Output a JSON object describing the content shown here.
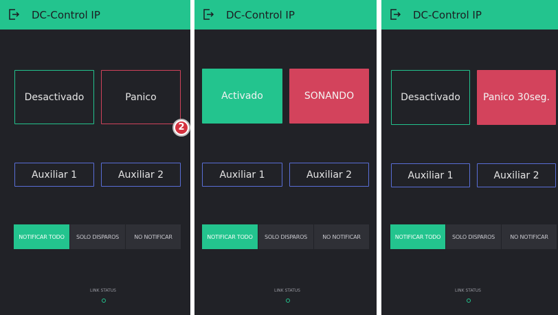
{
  "screens": [
    {
      "title": "DC-Control IP",
      "alarm_button": {
        "label": "Desactivado",
        "style": "outline",
        "color": "#23c48e"
      },
      "panic_button": {
        "label": "Panico",
        "style": "outline",
        "color": "#d3435c"
      },
      "aux1_label": "Auxiliar 1",
      "aux2_label": "Auxiliar 2",
      "segments": [
        "NOTIFICAR TODO",
        "SOLO DISPAROS",
        "NO NOTIFICAR"
      ],
      "active_segment": 0,
      "link_status_label": "LINK STATUS"
    },
    {
      "title": "DC-Control IP",
      "alarm_button": {
        "label": "Activado",
        "style": "filled",
        "color": "#23c48e"
      },
      "panic_button": {
        "label": "SONANDO",
        "style": "filled",
        "color": "#d3435c"
      },
      "aux1_label": "Auxiliar 1",
      "aux2_label": "Auxiliar 2",
      "segments": [
        "NOTIFICAR TODO",
        "SOLO DISPAROS",
        "NO NOTIFICAR"
      ],
      "active_segment": 0,
      "link_status_label": "LINK STATUS"
    },
    {
      "title": "DC-Control IP",
      "alarm_button": {
        "label": "Desactivado",
        "style": "outline",
        "color": "#23c48e"
      },
      "panic_button": {
        "label": "Panico 30seg.",
        "style": "filled",
        "color": "#d3435c"
      },
      "aux1_label": "Auxiliar 1",
      "aux2_label": "Auxiliar 2",
      "segments": [
        "NOTIFICAR TODO",
        "SOLO DISPAROS",
        "NO NOTIFICAR"
      ],
      "active_segment": 0,
      "link_status_label": "LINK STATUS"
    }
  ],
  "step_badge": "2",
  "colors": {
    "header": "#23c48e",
    "background": "#212227",
    "aux_border": "#5a6fd8",
    "segment_inactive": "#2f3036"
  }
}
